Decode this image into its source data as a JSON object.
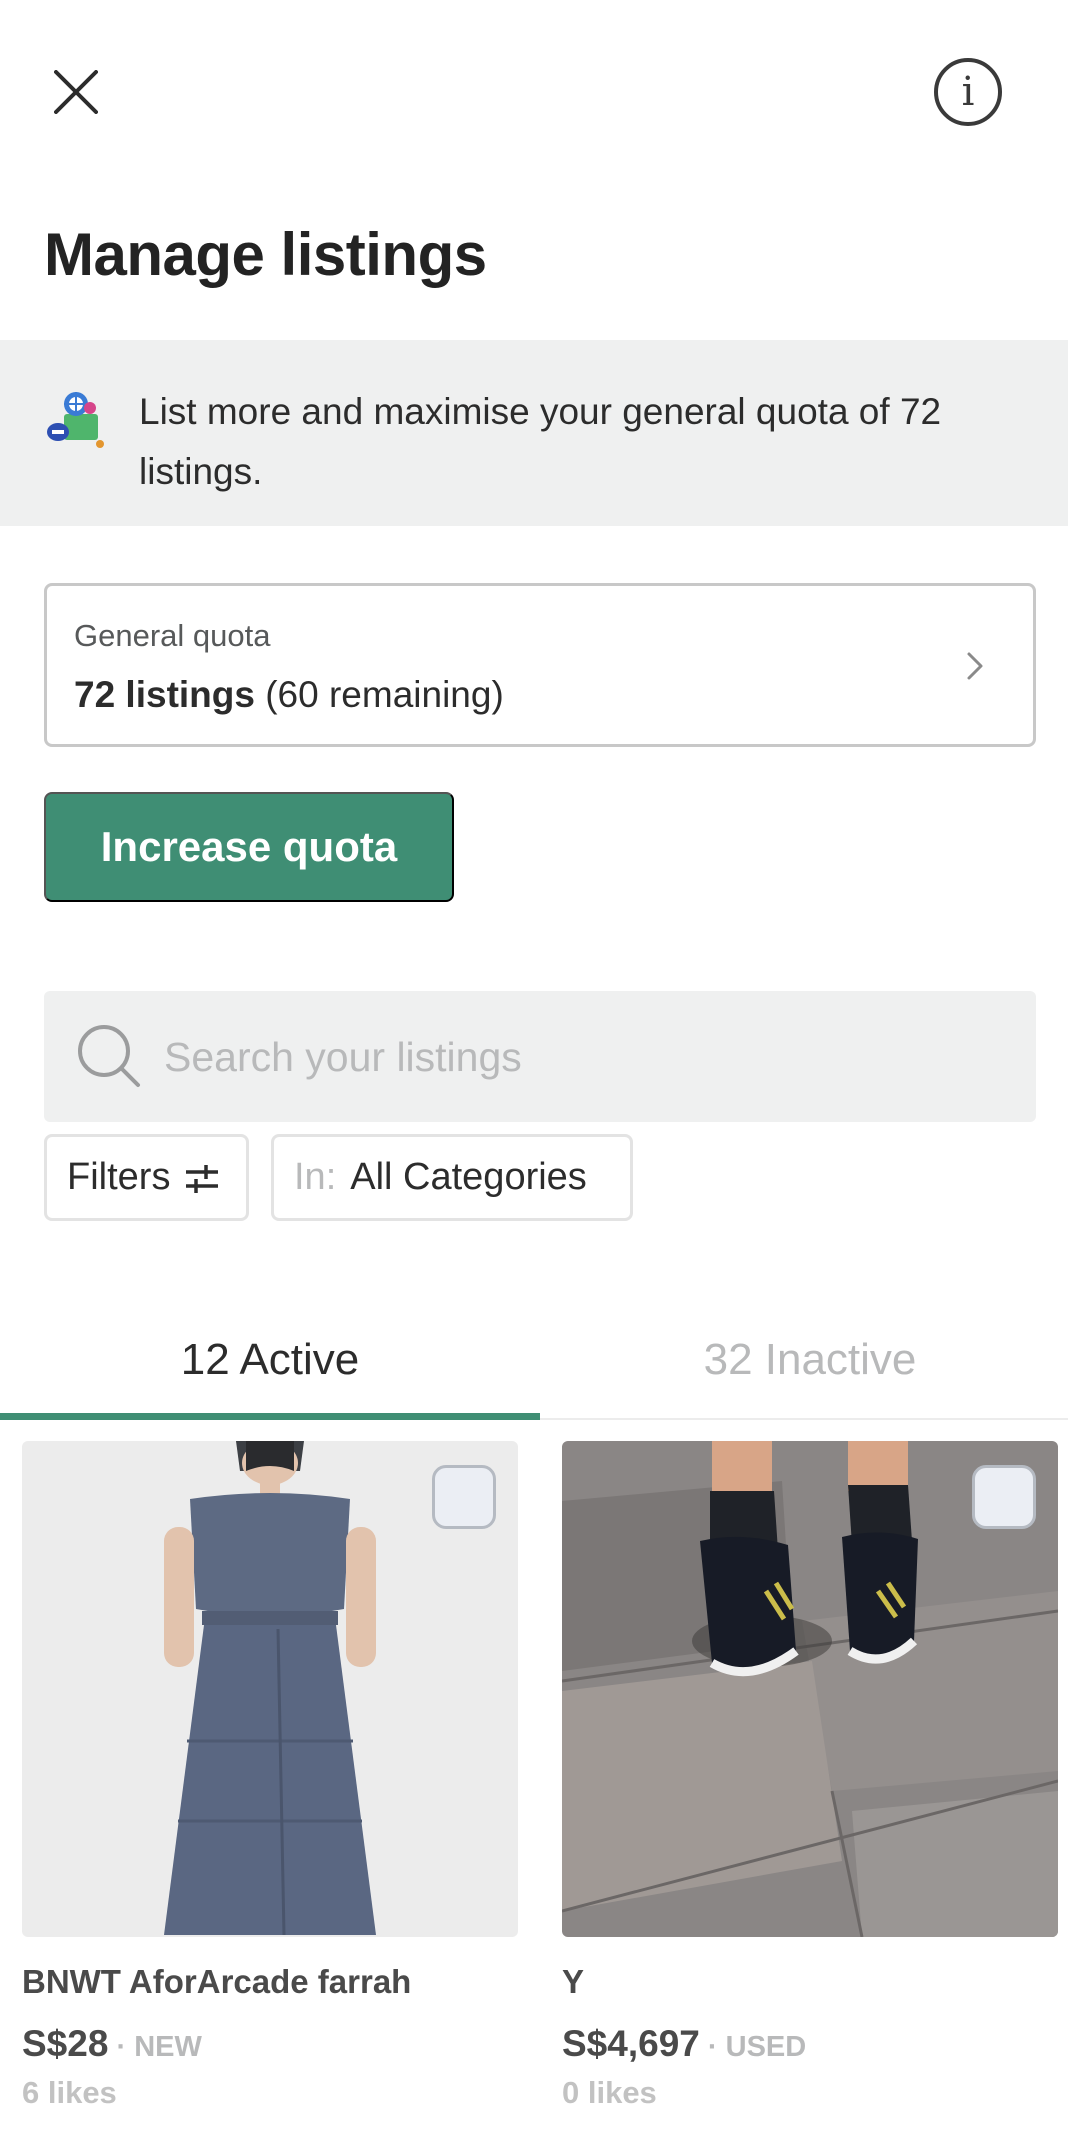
{
  "header": {
    "close_icon": "close-icon",
    "info_icon": "info-icon",
    "info_glyph": "i",
    "title": "Manage listings"
  },
  "banner": {
    "icon": "listings-illustration-icon",
    "text": "List more and maximise your general quota of 72 listings."
  },
  "quota": {
    "label": "General quota",
    "value_bold": "72 listings",
    "remaining": "(60 remaining)"
  },
  "actions": {
    "increase_label": "Increase quota"
  },
  "search": {
    "placeholder": "Search your listings",
    "value": ""
  },
  "filters": {
    "filters_label": "Filters",
    "category_prefix": "In:",
    "category_value": "All Categories"
  },
  "tabs": [
    {
      "label": "12 Active",
      "selected": true
    },
    {
      "label": "32 Inactive",
      "selected": false
    }
  ],
  "listings": [
    {
      "title": "BNWT AforArcade farrah",
      "price": "S$28",
      "condition": " · NEW",
      "likes": "6 likes",
      "image": "dress-photo"
    },
    {
      "title": "Y",
      "price": "S$4,697",
      "condition": " · USED",
      "likes": "0 likes",
      "image": "sneakers-photo"
    }
  ],
  "colors": {
    "accent": "#3f8e74",
    "banner_bg": "#eff0f0",
    "muted": "#b8b9ba"
  }
}
